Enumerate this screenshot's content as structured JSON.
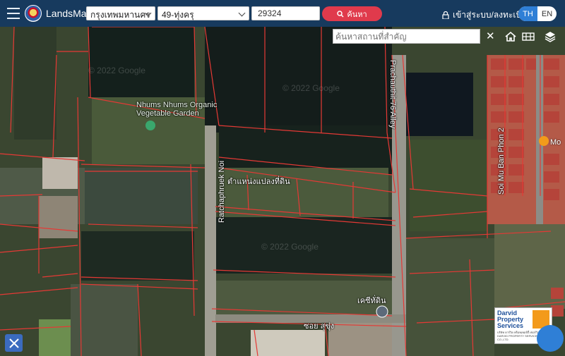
{
  "header": {
    "app_title": "LandsMaps",
    "province": "กรุงเทพมหานคร",
    "district": "49-ทุ่งครุ",
    "parcel_number": "29324",
    "search_label": "ค้นหา",
    "login_label": "เข้าสู่ระบบ/ลงทะเบียน",
    "lang_th": "TH",
    "lang_en": "EN"
  },
  "map": {
    "landmark_search_placeholder": "ค้นหาสถานที่สำคัญ",
    "labels": {
      "garden": "Nhums Nhums Organic Vegetable Garden",
      "parcel": "ตำแหน่งแปลงที่ดิน",
      "road_ratchaphruek": "Ratchaphruek Noi",
      "road_prachauthit": "Prachauthit 76 Alley",
      "road_soi_mu_ban": "Soi Mu Ban Phon 2",
      "poi": "เคซีทั่ดิน",
      "soi": "ซอย สุขุ่ง",
      "pin_partial": "Mo",
      "watermark": "© 2022 Google"
    },
    "badge": {
      "name_line1": "Darvid",
      "name_line2": "Property",
      "name_line3": "Services",
      "sub": "บริษัท ดาร์วิด พร็อพเพอร์ตี้ เซอร์วิส จำกัด DARVID PROPERTY SERVICES CO.,LTD."
    },
    "icons": [
      "home-icon",
      "grid-icon",
      "layers-icon",
      "tools-icon",
      "close-icon",
      "pin-icon"
    ],
    "parcel_line_color": "#e53935"
  }
}
